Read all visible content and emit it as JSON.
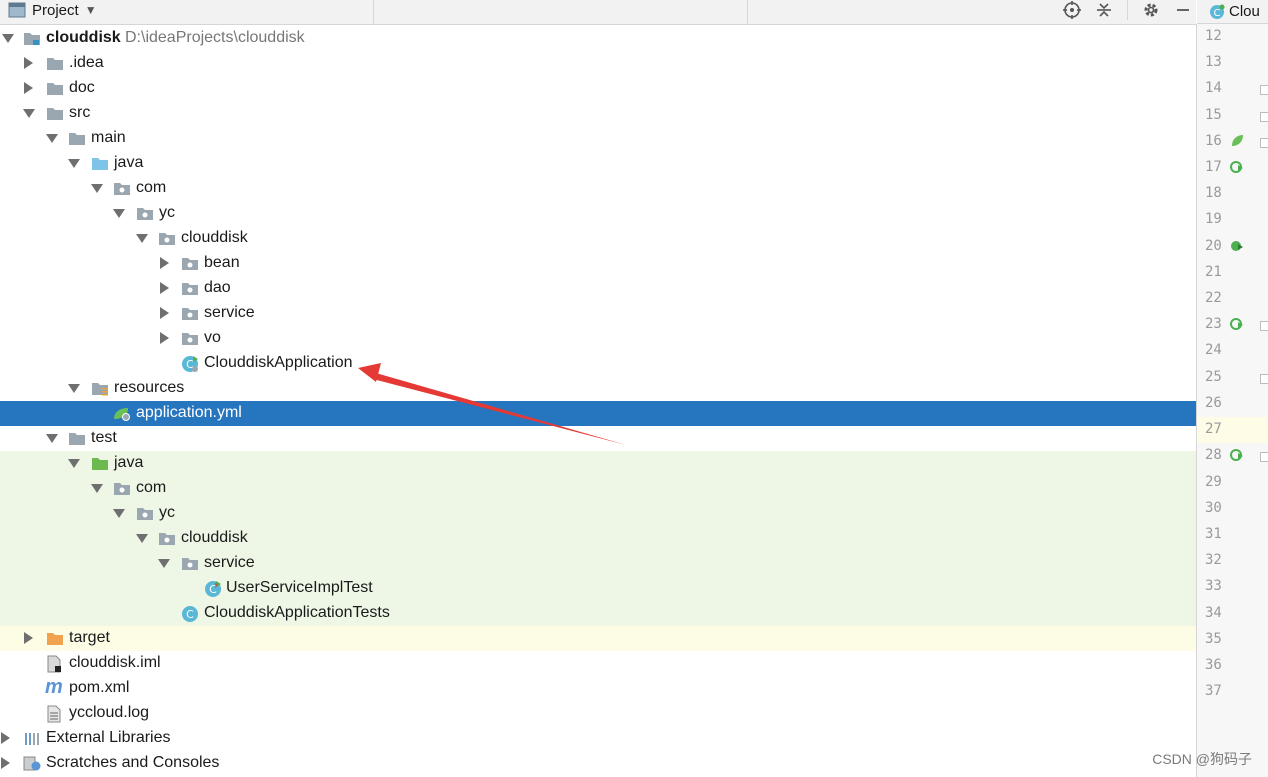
{
  "header": {
    "title": "Project",
    "dropdown_glyph": "▼",
    "icons": [
      "target-icon",
      "collapse-icon",
      "gear-icon",
      "minimize-icon"
    ]
  },
  "editor": {
    "tab_label": "Clou",
    "line_numbers": [
      "12",
      "13",
      "14",
      "15",
      "16",
      "17",
      "18",
      "19",
      "20",
      "21",
      "22",
      "23",
      "24",
      "25",
      "26",
      "27",
      "28",
      "29",
      "30",
      "31",
      "32",
      "33",
      "34",
      "35",
      "36",
      "37"
    ],
    "current_line": "27"
  },
  "tree": {
    "root": {
      "name": "clouddisk",
      "path": "D:\\ideaProjects\\clouddisk"
    },
    "items": [
      {
        "label": ".idea"
      },
      {
        "label": "doc"
      },
      {
        "label": "src"
      },
      {
        "label": "main"
      },
      {
        "label": "java"
      },
      {
        "label": "com"
      },
      {
        "label": "yc"
      },
      {
        "label": "clouddisk"
      },
      {
        "label": "bean"
      },
      {
        "label": "dao"
      },
      {
        "label": "service"
      },
      {
        "label": "vo"
      },
      {
        "label": "ClouddiskApplication"
      },
      {
        "label": "resources"
      },
      {
        "label": "application.yml"
      },
      {
        "label": "test"
      },
      {
        "label": "java"
      },
      {
        "label": "com"
      },
      {
        "label": "yc"
      },
      {
        "label": "clouddisk"
      },
      {
        "label": "service"
      },
      {
        "label": "UserServiceImplTest"
      },
      {
        "label": "ClouddiskApplicationTests"
      },
      {
        "label": "target"
      },
      {
        "label": "clouddisk.iml"
      },
      {
        "label": "pom.xml"
      },
      {
        "label": "yccloud.log"
      },
      {
        "label": "External Libraries"
      },
      {
        "label": "Scratches and Consoles"
      }
    ]
  },
  "colors": {
    "selection": "#2675bf",
    "test_bg": "#eef7e6",
    "target_bg": "#fdfde6",
    "annotation_arrow": "#e53935"
  },
  "watermark": "CSDN @狗码子"
}
